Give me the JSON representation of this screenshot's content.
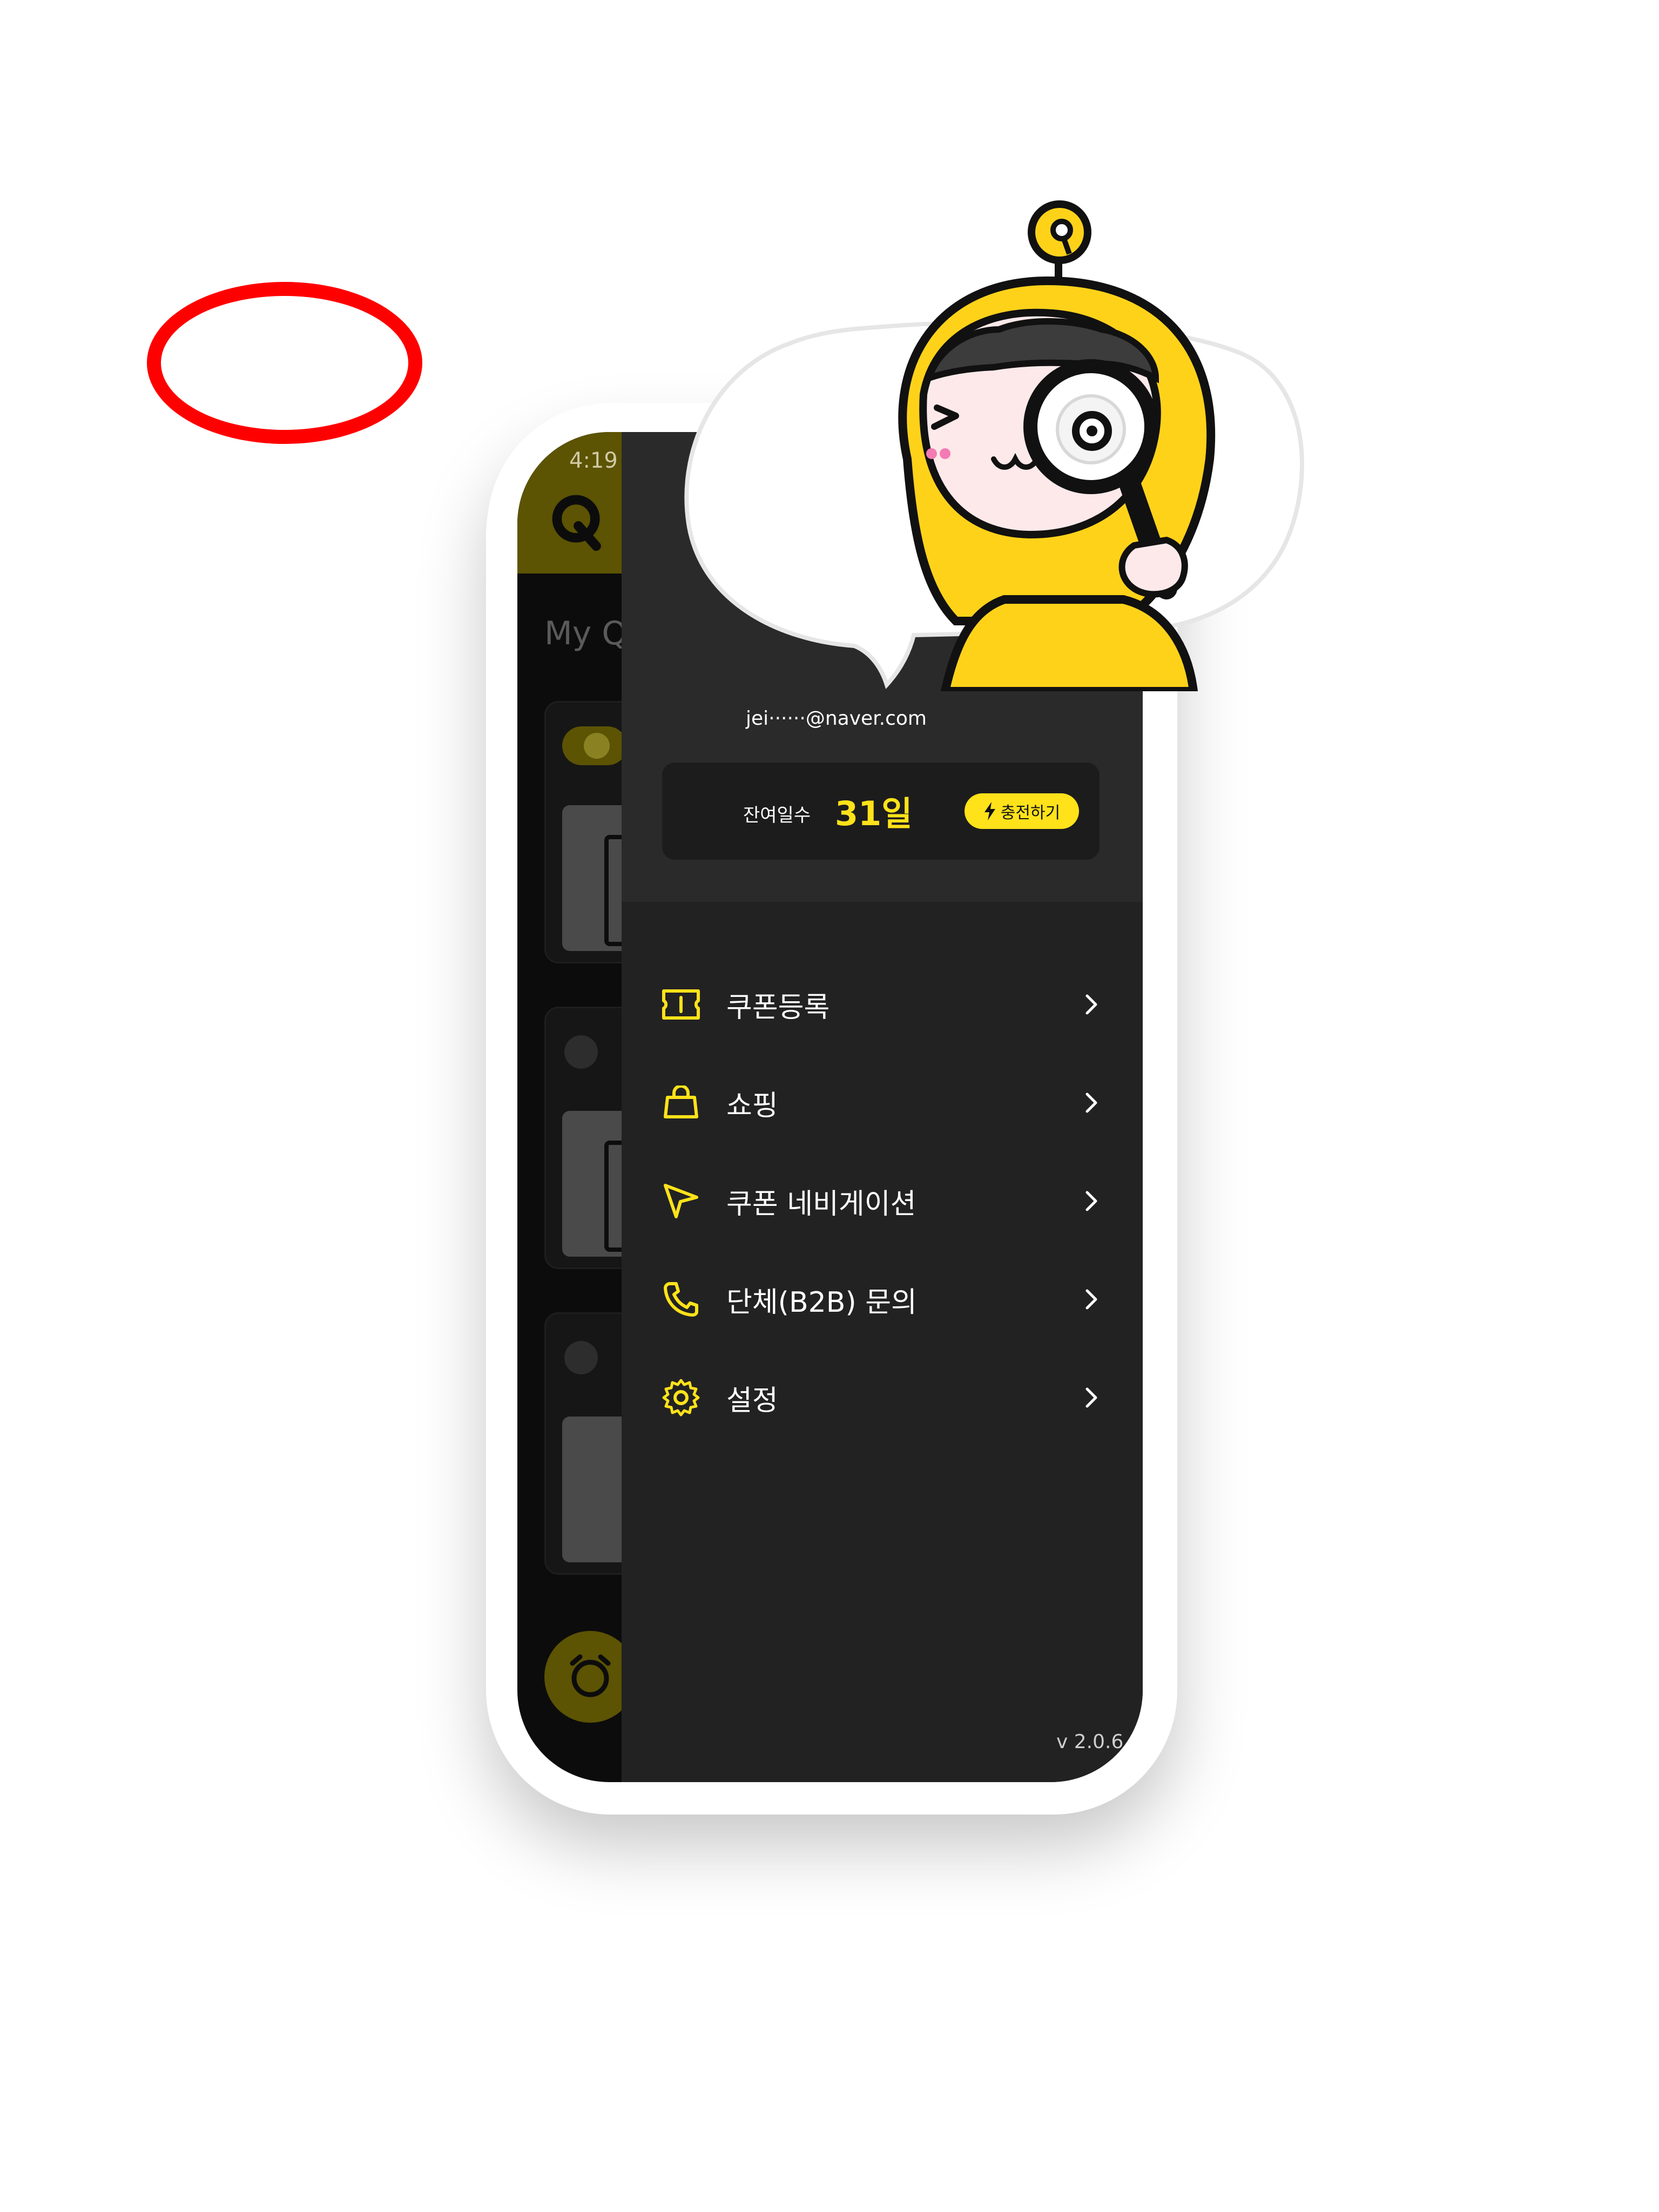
{
  "app": {
    "status_time": "4:19",
    "section_title": "My Q"
  },
  "drawer": {
    "email": "jei······@naver.com",
    "remaining_days": {
      "label": "잔여일수",
      "value": "31일"
    },
    "charge_button": "충전하기",
    "menu": [
      {
        "label": "쿠폰등록",
        "icon": "coupon-icon"
      },
      {
        "label": "쇼핑",
        "icon": "shopping-bag-icon"
      },
      {
        "label": "쿠폰 네비게이션",
        "icon": "navigation-arrow-icon"
      },
      {
        "label": "단체(B2B) 문의",
        "icon": "phone-icon"
      },
      {
        "label": "설정",
        "icon": "gear-icon"
      }
    ],
    "version": "v 2.0.6"
  },
  "colors": {
    "accent": "#ffe21a",
    "drawer_bg": "#222222",
    "annotation": "#ff0000"
  }
}
